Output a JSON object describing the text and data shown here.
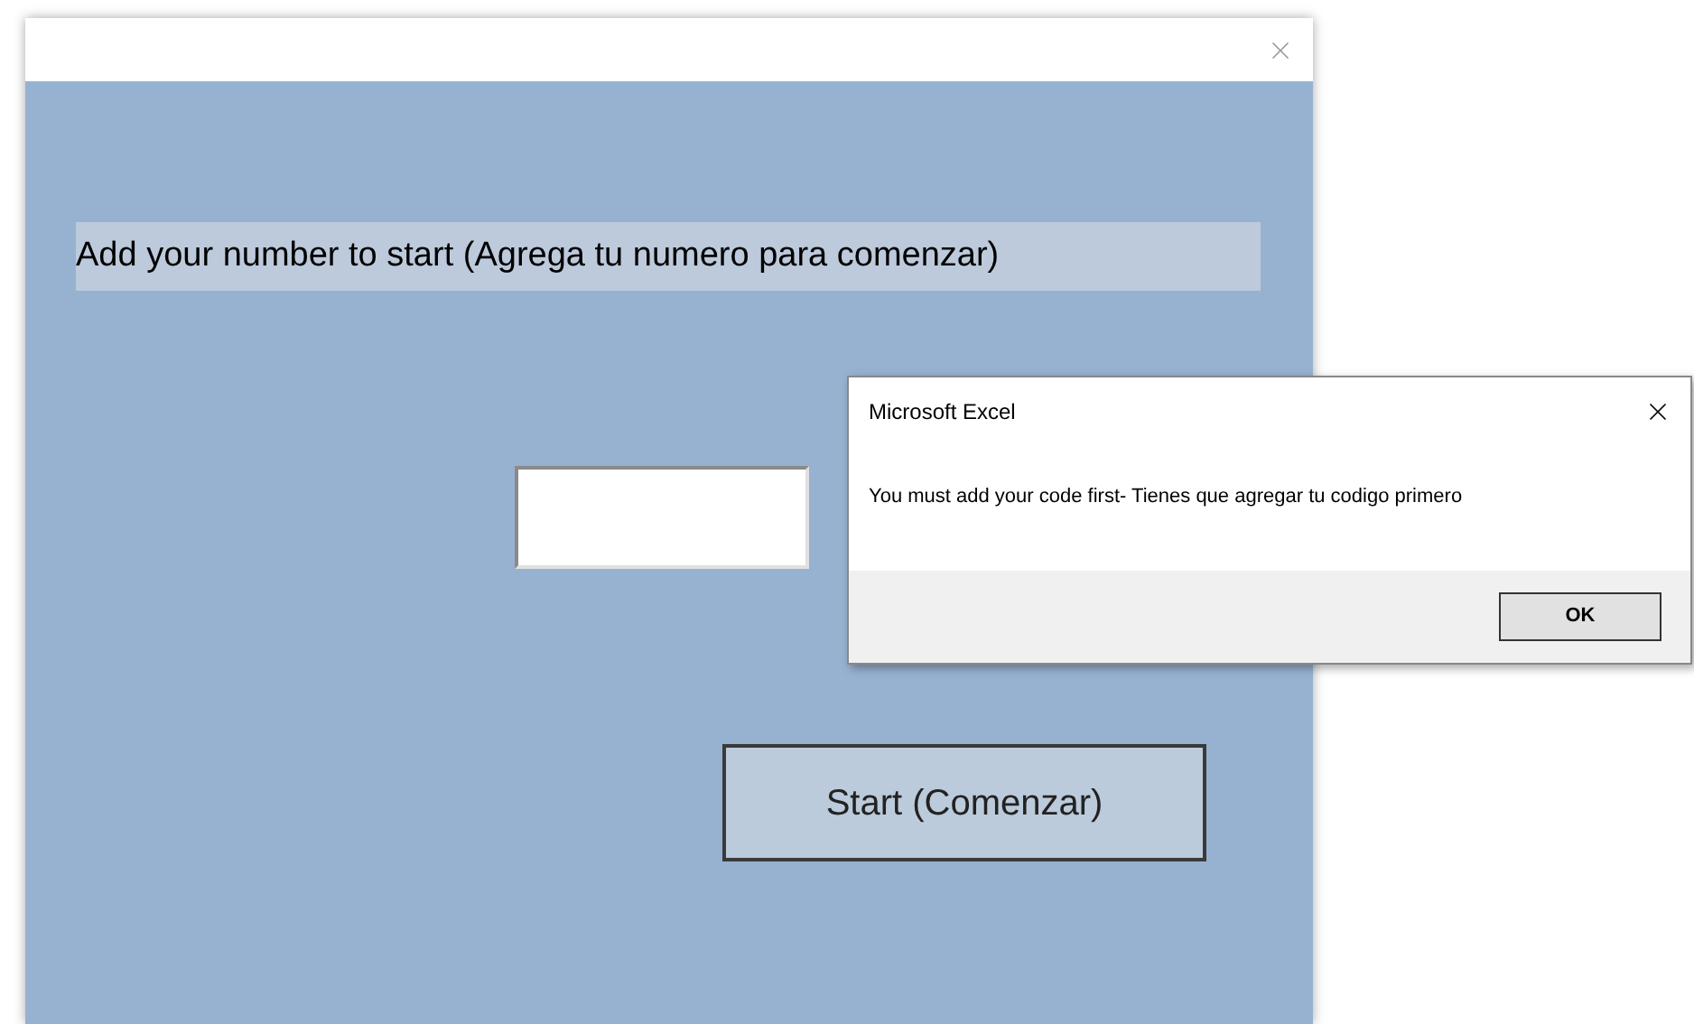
{
  "form": {
    "prompt": "Add your number to start (Agrega tu numero para comenzar)",
    "start_button": "Start (Comenzar)"
  },
  "message_box": {
    "title": "Microsoft Excel",
    "message": "You must add your code first- Tienes que agregar tu codigo primero",
    "buttons": [
      "OK"
    ]
  }
}
